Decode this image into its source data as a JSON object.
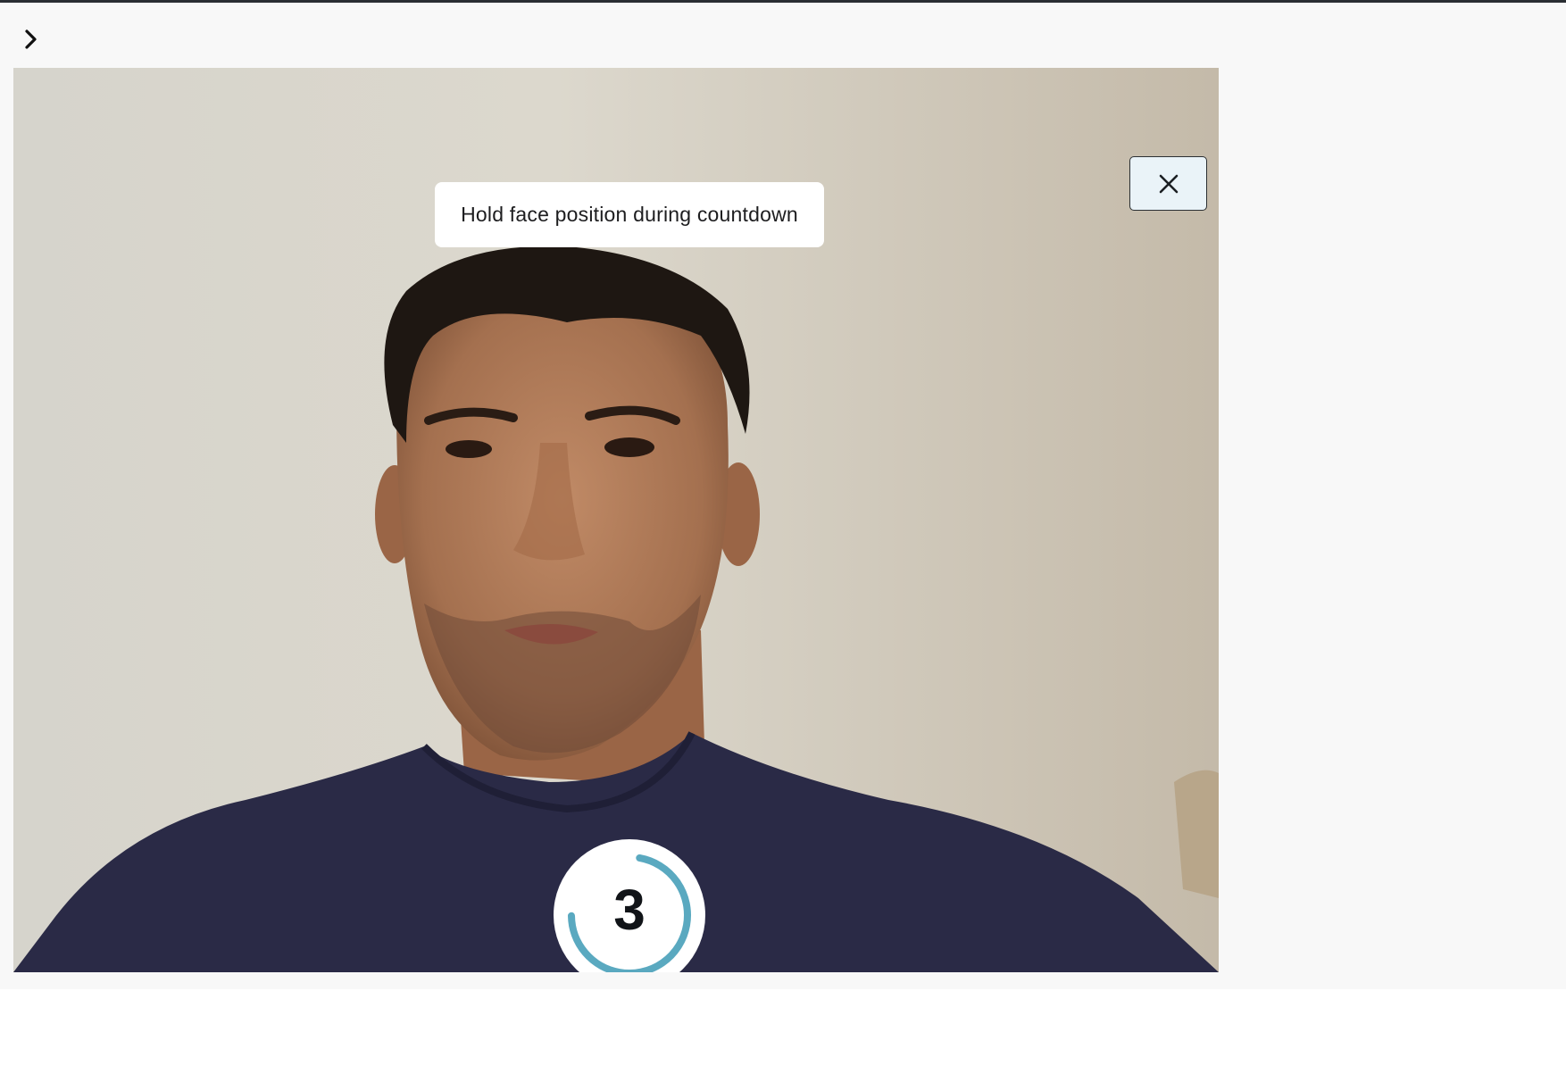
{
  "instruction": "Hold face position during countdown",
  "countdown": {
    "number": "3",
    "progress": 0.72
  },
  "colors": {
    "progress_ring": "#5aa9c0",
    "close_button_bg": "#eaf3f8"
  },
  "icons": {
    "expand": "chevron-right-icon",
    "close": "close-icon"
  }
}
